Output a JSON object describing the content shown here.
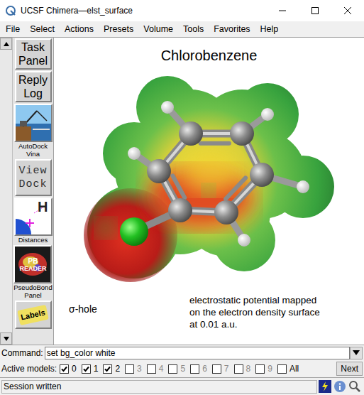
{
  "window": {
    "title": "UCSF Chimera—elst_surface"
  },
  "menu": [
    "File",
    "Select",
    "Actions",
    "Presets",
    "Volume",
    "Tools",
    "Favorites",
    "Help"
  ],
  "toolbar": [
    {
      "kind": "text",
      "lines": [
        "Task",
        "Panel"
      ]
    },
    {
      "kind": "text",
      "lines": [
        "Reply",
        "Log"
      ]
    },
    {
      "kind": "vina",
      "lines": [
        "AutoDock",
        "Vina"
      ]
    },
    {
      "kind": "viewdock",
      "lines": [
        "View",
        "Dock"
      ]
    },
    {
      "kind": "distances",
      "icon_text": "H",
      "lines": [
        "Distances"
      ]
    },
    {
      "kind": "pbreader",
      "icon_text": [
        "PB",
        "READER"
      ],
      "lines": [
        "PseudoBond",
        "Panel"
      ]
    },
    {
      "kind": "labels",
      "lines": [
        "Labels"
      ]
    }
  ],
  "canvas": {
    "title": "Chlorobenzene",
    "annotation": "σ-hole",
    "caption": [
      "electrostatic potential mapped",
      "on the electron density surface",
      "at 0.01 a.u."
    ]
  },
  "command": {
    "label": "Command:",
    "value": "set bg_color white"
  },
  "active_models": {
    "label": "Active models:",
    "models": [
      {
        "label": "0",
        "checked": true
      },
      {
        "label": "1",
        "checked": true
      },
      {
        "label": "2",
        "checked": true
      },
      {
        "label": "3",
        "checked": false
      },
      {
        "label": "4",
        "checked": false
      },
      {
        "label": "5",
        "checked": false
      },
      {
        "label": "6",
        "checked": false
      },
      {
        "label": "7",
        "checked": false
      },
      {
        "label": "8",
        "checked": false
      },
      {
        "label": "9",
        "checked": false
      },
      {
        "label": "All",
        "checked": false
      }
    ],
    "next": "Next"
  },
  "status": {
    "text": "Session written"
  }
}
